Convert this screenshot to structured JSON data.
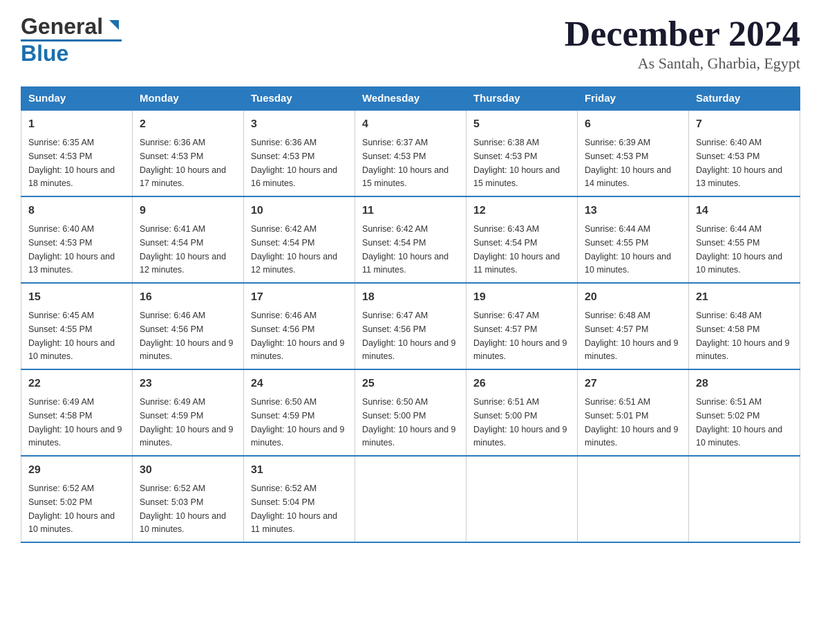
{
  "header": {
    "logo_general": "General",
    "logo_blue": "Blue",
    "title": "December 2024",
    "subtitle": "As Santah, Gharbia, Egypt"
  },
  "days_of_week": [
    "Sunday",
    "Monday",
    "Tuesday",
    "Wednesday",
    "Thursday",
    "Friday",
    "Saturday"
  ],
  "weeks": [
    [
      {
        "day": "1",
        "sunrise": "6:35 AM",
        "sunset": "4:53 PM",
        "daylight": "10 hours and 18 minutes."
      },
      {
        "day": "2",
        "sunrise": "6:36 AM",
        "sunset": "4:53 PM",
        "daylight": "10 hours and 17 minutes."
      },
      {
        "day": "3",
        "sunrise": "6:36 AM",
        "sunset": "4:53 PM",
        "daylight": "10 hours and 16 minutes."
      },
      {
        "day": "4",
        "sunrise": "6:37 AM",
        "sunset": "4:53 PM",
        "daylight": "10 hours and 15 minutes."
      },
      {
        "day": "5",
        "sunrise": "6:38 AM",
        "sunset": "4:53 PM",
        "daylight": "10 hours and 15 minutes."
      },
      {
        "day": "6",
        "sunrise": "6:39 AM",
        "sunset": "4:53 PM",
        "daylight": "10 hours and 14 minutes."
      },
      {
        "day": "7",
        "sunrise": "6:40 AM",
        "sunset": "4:53 PM",
        "daylight": "10 hours and 13 minutes."
      }
    ],
    [
      {
        "day": "8",
        "sunrise": "6:40 AM",
        "sunset": "4:53 PM",
        "daylight": "10 hours and 13 minutes."
      },
      {
        "day": "9",
        "sunrise": "6:41 AM",
        "sunset": "4:54 PM",
        "daylight": "10 hours and 12 minutes."
      },
      {
        "day": "10",
        "sunrise": "6:42 AM",
        "sunset": "4:54 PM",
        "daylight": "10 hours and 12 minutes."
      },
      {
        "day": "11",
        "sunrise": "6:42 AM",
        "sunset": "4:54 PM",
        "daylight": "10 hours and 11 minutes."
      },
      {
        "day": "12",
        "sunrise": "6:43 AM",
        "sunset": "4:54 PM",
        "daylight": "10 hours and 11 minutes."
      },
      {
        "day": "13",
        "sunrise": "6:44 AM",
        "sunset": "4:55 PM",
        "daylight": "10 hours and 10 minutes."
      },
      {
        "day": "14",
        "sunrise": "6:44 AM",
        "sunset": "4:55 PM",
        "daylight": "10 hours and 10 minutes."
      }
    ],
    [
      {
        "day": "15",
        "sunrise": "6:45 AM",
        "sunset": "4:55 PM",
        "daylight": "10 hours and 10 minutes."
      },
      {
        "day": "16",
        "sunrise": "6:46 AM",
        "sunset": "4:56 PM",
        "daylight": "10 hours and 9 minutes."
      },
      {
        "day": "17",
        "sunrise": "6:46 AM",
        "sunset": "4:56 PM",
        "daylight": "10 hours and 9 minutes."
      },
      {
        "day": "18",
        "sunrise": "6:47 AM",
        "sunset": "4:56 PM",
        "daylight": "10 hours and 9 minutes."
      },
      {
        "day": "19",
        "sunrise": "6:47 AM",
        "sunset": "4:57 PM",
        "daylight": "10 hours and 9 minutes."
      },
      {
        "day": "20",
        "sunrise": "6:48 AM",
        "sunset": "4:57 PM",
        "daylight": "10 hours and 9 minutes."
      },
      {
        "day": "21",
        "sunrise": "6:48 AM",
        "sunset": "4:58 PM",
        "daylight": "10 hours and 9 minutes."
      }
    ],
    [
      {
        "day": "22",
        "sunrise": "6:49 AM",
        "sunset": "4:58 PM",
        "daylight": "10 hours and 9 minutes."
      },
      {
        "day": "23",
        "sunrise": "6:49 AM",
        "sunset": "4:59 PM",
        "daylight": "10 hours and 9 minutes."
      },
      {
        "day": "24",
        "sunrise": "6:50 AM",
        "sunset": "4:59 PM",
        "daylight": "10 hours and 9 minutes."
      },
      {
        "day": "25",
        "sunrise": "6:50 AM",
        "sunset": "5:00 PM",
        "daylight": "10 hours and 9 minutes."
      },
      {
        "day": "26",
        "sunrise": "6:51 AM",
        "sunset": "5:00 PM",
        "daylight": "10 hours and 9 minutes."
      },
      {
        "day": "27",
        "sunrise": "6:51 AM",
        "sunset": "5:01 PM",
        "daylight": "10 hours and 9 minutes."
      },
      {
        "day": "28",
        "sunrise": "6:51 AM",
        "sunset": "5:02 PM",
        "daylight": "10 hours and 10 minutes."
      }
    ],
    [
      {
        "day": "29",
        "sunrise": "6:52 AM",
        "sunset": "5:02 PM",
        "daylight": "10 hours and 10 minutes."
      },
      {
        "day": "30",
        "sunrise": "6:52 AM",
        "sunset": "5:03 PM",
        "daylight": "10 hours and 10 minutes."
      },
      {
        "day": "31",
        "sunrise": "6:52 AM",
        "sunset": "5:04 PM",
        "daylight": "10 hours and 11 minutes."
      },
      null,
      null,
      null,
      null
    ]
  ],
  "labels": {
    "sunrise": "Sunrise:",
    "sunset": "Sunset:",
    "daylight": "Daylight:"
  }
}
